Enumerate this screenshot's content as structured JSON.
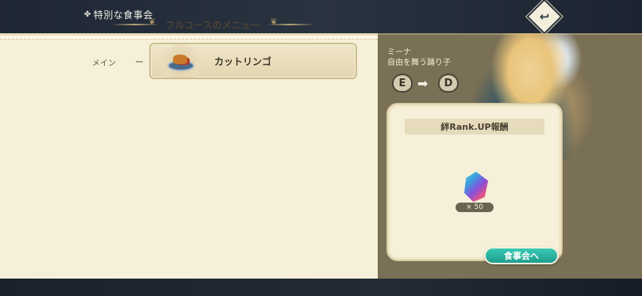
{
  "header": {
    "title": "特別な食事会",
    "title_icon": "utensils-icon",
    "back_icon": "back-arrow-icon"
  },
  "menu": {
    "heading": "フルコースのメニュー",
    "courses": [
      {
        "label": "メイン",
        "dash": "ー",
        "dish_name": "カットリンゴ",
        "dish_icon": "cut-apple-dish-icon"
      }
    ]
  },
  "character": {
    "name": "ミーナ",
    "title": "自由を舞う踊り子",
    "rank_from": "E",
    "rank_to": "D"
  },
  "reward": {
    "heading": "絆Rank.UP報酬",
    "item_icon": "rainbow-gem-icon",
    "quantity": "× 50"
  },
  "actions": {
    "go_label": "食事会へ"
  },
  "colors": {
    "panel": "#f6f0d9",
    "accent_button": "#2bb4a0",
    "right_bg": "#7a7056"
  }
}
